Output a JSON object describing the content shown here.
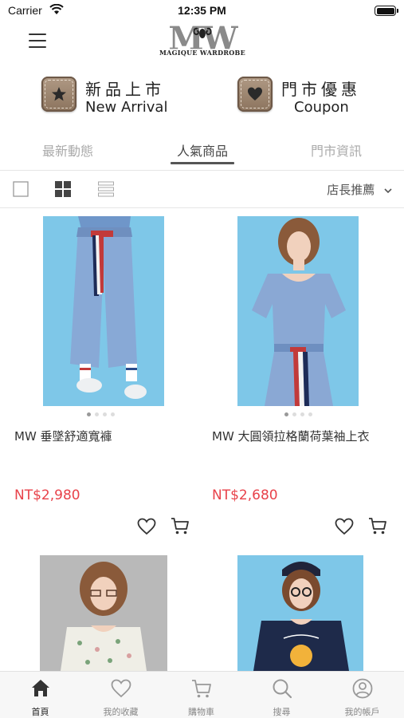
{
  "status_bar": {
    "carrier": "Carrier",
    "time": "12:35 PM"
  },
  "header": {
    "logo_text": "MW",
    "logo_subtext": "MAGIQUE WARDROBE"
  },
  "shortcuts": [
    {
      "label_zh": "新品上市",
      "label_en": "New Arrival",
      "icon": "star-icon"
    },
    {
      "label_zh": "門市優惠",
      "label_en": "Coupon",
      "icon": "heart-icon"
    }
  ],
  "tabs": [
    {
      "label": "最新動態",
      "active": false
    },
    {
      "label": "人氣商品",
      "active": true
    },
    {
      "label": "門市資訊",
      "active": false
    }
  ],
  "view_options": [
    "single-view-icon",
    "grid-view-icon",
    "list-view-icon"
  ],
  "sort": {
    "label": "店長推薦"
  },
  "products": [
    {
      "name": "MW 垂墜舒適寬褲",
      "price": "NT$2,980",
      "image_count": 4,
      "current_image": 1
    },
    {
      "name": "MW 大圓領拉格蘭荷葉袖上衣",
      "price": "NT$2,680",
      "image_count": 4,
      "current_image": 1
    },
    {
      "name": "",
      "price": "",
      "image_count": 0,
      "current_image": 0
    },
    {
      "name": "",
      "price": "",
      "image_count": 0,
      "current_image": 0
    }
  ],
  "bottom_nav": [
    {
      "label": "首頁",
      "icon": "home-icon",
      "active": true
    },
    {
      "label": "我的收藏",
      "icon": "heart-icon",
      "active": false
    },
    {
      "label": "購物車",
      "icon": "cart-icon",
      "active": false
    },
    {
      "label": "搜尋",
      "icon": "search-icon",
      "active": false
    },
    {
      "label": "我的帳戶",
      "icon": "account-icon",
      "active": false
    }
  ],
  "colors": {
    "price": "#e8424a",
    "image_bg": "#7ec7e8",
    "image_bg_alt": "#b9b9b9",
    "badge": "#8b735d"
  }
}
